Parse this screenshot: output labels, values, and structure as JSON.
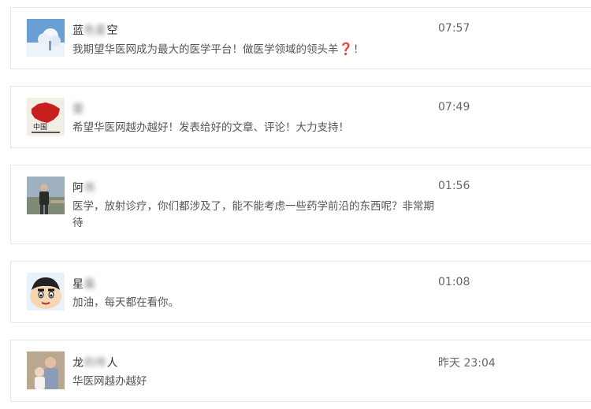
{
  "comments": [
    {
      "name_visible_start": "蓝",
      "name_blurred": "色星",
      "name_visible_end": "空",
      "time": "07:57",
      "text": "我期望华医网成为最大的医学平台！做医学领域的领头羊",
      "text_mark": "❓",
      "text_end": "！",
      "avatar": "snowy-tree-avatar"
    },
    {
      "name_visible_start": "",
      "name_blurred": "雲",
      "name_visible_end": "",
      "time": "07:49",
      "text": "希望华医网越办越好！发表给好的文章、评论！大力支持！",
      "avatar": "china-map-avatar"
    },
    {
      "name_visible_start": "阿",
      "name_blurred": "伟",
      "name_visible_end": "",
      "time": "01:56",
      "text": "医学，放射诊疗，你们都涉及了，能不能考虑一些药学前沿的东西呢？非常期待",
      "avatar": "man-outdoor-avatar"
    },
    {
      "name_visible_start": "星",
      "name_blurred": "晨",
      "name_visible_end": "",
      "time": "01:08",
      "text": "加油，每天都在看你。",
      "avatar": "cartoon-boy-avatar"
    },
    {
      "name_visible_start": "龙",
      "name_blurred": "的传",
      "name_visible_end": "人",
      "time": "昨天 23:04",
      "text": "华医网越办越好",
      "avatar": "father-child-avatar"
    }
  ]
}
